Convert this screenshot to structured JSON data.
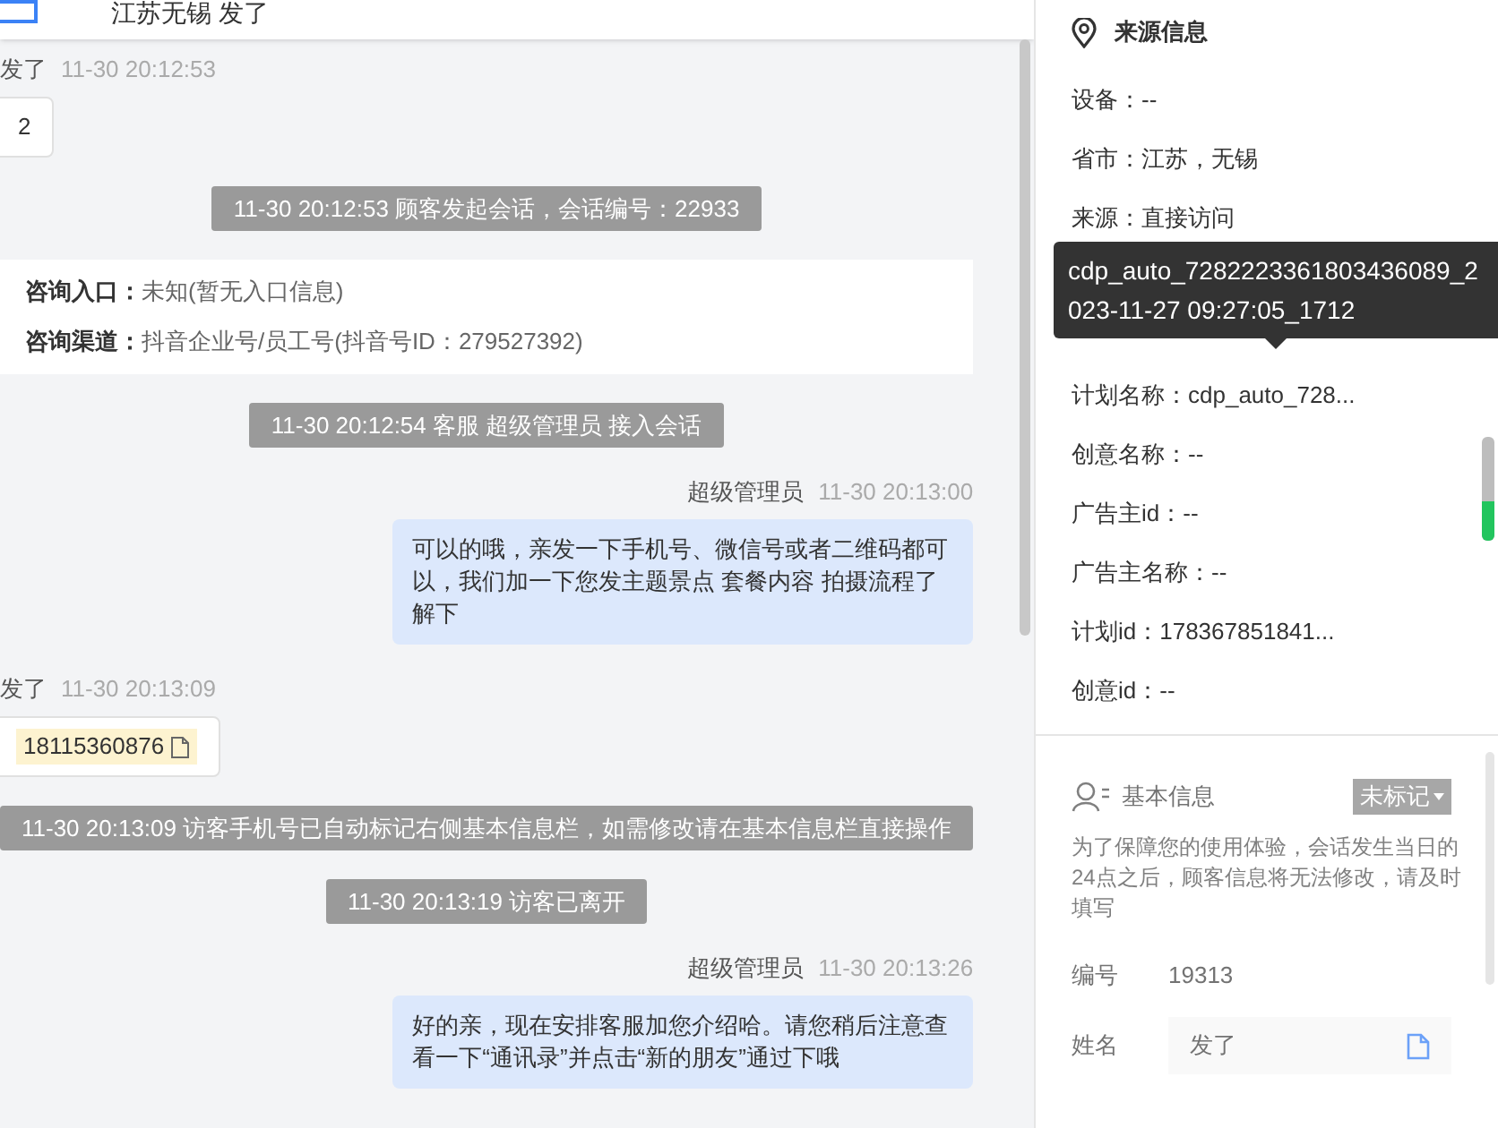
{
  "header": {
    "title": "江苏无锡 发了"
  },
  "messages": [
    {
      "kind": "customer",
      "sender": "发了",
      "time": "11-30 20:12:53",
      "text": "2"
    },
    {
      "kind": "system",
      "text": "11-30 20:12:53 顾客发起会话，会话编号：22933"
    },
    {
      "kind": "entry_card",
      "fields": [
        {
          "label": "咨询入口：",
          "value": "未知(暂无入口信息)"
        },
        {
          "label": "咨询渠道：",
          "value": "抖音企业号/员工号(抖音号ID：279527392)"
        }
      ]
    },
    {
      "kind": "system",
      "text": "11-30 20:12:54 客服 超级管理员 接入会话"
    },
    {
      "kind": "agent",
      "sender": "超级管理员",
      "time": "11-30 20:13:00",
      "text": "可以的哦，亲发一下手机号、微信号或者二维码都可以，我们加一下您发主题景点 套餐内容 拍摄流程了解下"
    },
    {
      "kind": "customer_phone",
      "sender": "发了",
      "time": "11-30 20:13:09",
      "text": "18115360876"
    },
    {
      "kind": "system",
      "text": "11-30 20:13:09 访客手机号已自动标记右侧基本信息栏，如需修改请在基本信息栏直接操作"
    },
    {
      "kind": "system",
      "text": "11-30 20:13:19 访客已离开"
    },
    {
      "kind": "agent",
      "sender": "超级管理员",
      "time": "11-30 20:13:26",
      "text": "好的亲，现在安排客服加您介绍哈。请您稍后注意查看一下“通讯录”并点击“新的朋友”通过下哦"
    }
  ],
  "source_info": {
    "title": "来源信息",
    "rows": [
      {
        "kind": "field",
        "text": "设备：--"
      },
      {
        "kind": "field",
        "text": "省市：江苏，无锡"
      },
      {
        "kind": "field",
        "text": "来源：直接访问"
      },
      {
        "kind": "tooltip",
        "text": "cdp_auto_7282223361803436089_2023-11-27 09:27:05_1712"
      },
      {
        "kind": "field",
        "text": "计划名称：cdp_auto_728..."
      },
      {
        "kind": "field",
        "text": "创意名称：--"
      },
      {
        "kind": "field",
        "text": "广告主id：--"
      },
      {
        "kind": "field",
        "text": "广告主名称：--"
      },
      {
        "kind": "field",
        "text": "计划id：178367851841..."
      },
      {
        "kind": "field",
        "text": "创意id：--"
      }
    ]
  },
  "basic_info": {
    "title": "基本信息",
    "disabled": true,
    "tag": "未标记",
    "notice": "为了保障您的使用体验，会话发生当日的24点之后，顾客信息将无法修改，请及时填写",
    "fields": [
      {
        "kind": "text",
        "label": "编号",
        "value": "19313"
      },
      {
        "kind": "input",
        "label": "姓名",
        "value": "发了"
      }
    ]
  }
}
